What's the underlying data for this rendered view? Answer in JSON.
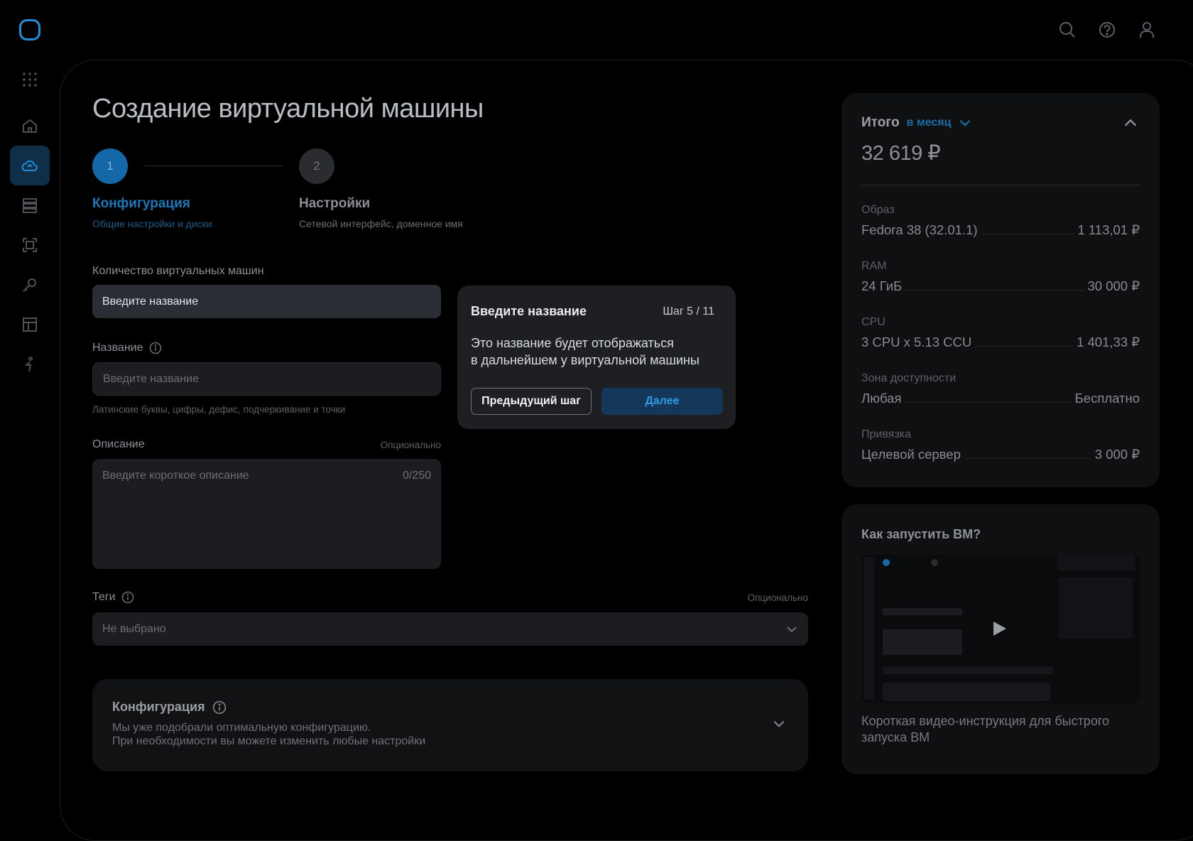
{
  "header": {
    "icons": [
      "search-icon",
      "help-icon",
      "user-icon"
    ]
  },
  "sidebar": {
    "items": [
      {
        "icon": "apps-grid-icon"
      },
      {
        "icon": "home-icon"
      },
      {
        "icon": "cloud-icon",
        "active": true
      },
      {
        "icon": "storage-icon"
      },
      {
        "icon": "frame-icon"
      },
      {
        "icon": "key-icon"
      },
      {
        "icon": "layout-icon"
      },
      {
        "icon": "person-icon"
      }
    ]
  },
  "page": {
    "title": "Создание виртуальной машины"
  },
  "stepper": {
    "steps": [
      {
        "number": "1",
        "title": "Конфигурация",
        "subtitle": "Общие настройки и диски",
        "active": true
      },
      {
        "number": "2",
        "title": "Настройки",
        "subtitle": "Сетевой интерфейс, доменное имя",
        "active": false
      }
    ]
  },
  "form": {
    "vm_count": {
      "label": "Количество виртуальных машин",
      "value": "Введите название"
    },
    "name": {
      "label": "Название",
      "placeholder": "Введите название",
      "hint": "Латинские буквы, цифры, дефис, подчеркивание и точки"
    },
    "description": {
      "label": "Описание",
      "optional": "Опционально",
      "placeholder": "Введите короткое описание",
      "counter": "0/250"
    },
    "tags": {
      "label": "Теги",
      "optional": "Опционально",
      "value": "Не выбрано"
    },
    "config": {
      "title": "Конфигурация",
      "line1": "Мы уже подобрали оптимальную конфигурацию.",
      "line2": "При необходимости вы можете изменить любые настройки"
    }
  },
  "tour": {
    "title": "Введите название",
    "step": "Шаг 5 / 11",
    "body_line1": "Это название будет отображаться",
    "body_line2": "в дальнейшем у виртуальной машины",
    "prev_label": "Предыдущий шаг",
    "next_label": "Далее"
  },
  "summary": {
    "title": "Итого",
    "period": "в месяц",
    "total": "32 619 ₽",
    "rows": [
      {
        "label": "Образ",
        "name": "Fedora 38 (32.01.1)",
        "price": "1 113,01 ₽"
      },
      {
        "label": "RAM",
        "name": "24 ГиБ",
        "price": "30 000 ₽"
      },
      {
        "label": "CPU",
        "name": "3 CPU x 5.13 CCU",
        "price": "1 401,33 ₽"
      },
      {
        "label": "Зона доступности",
        "name": "Любая",
        "price": "Бесплатно"
      },
      {
        "label": "Привязка",
        "name": "Целевой сервер",
        "price": "3 000 ₽"
      }
    ]
  },
  "howto": {
    "title": "Как запустить ВМ?",
    "caption_line1": "Короткая видео-инструкция для быстрого",
    "caption_line2": "запуска ВМ"
  },
  "colors": {
    "accent": "#1f8fd9",
    "accent_dark": "#14375a",
    "background": "#000000"
  }
}
